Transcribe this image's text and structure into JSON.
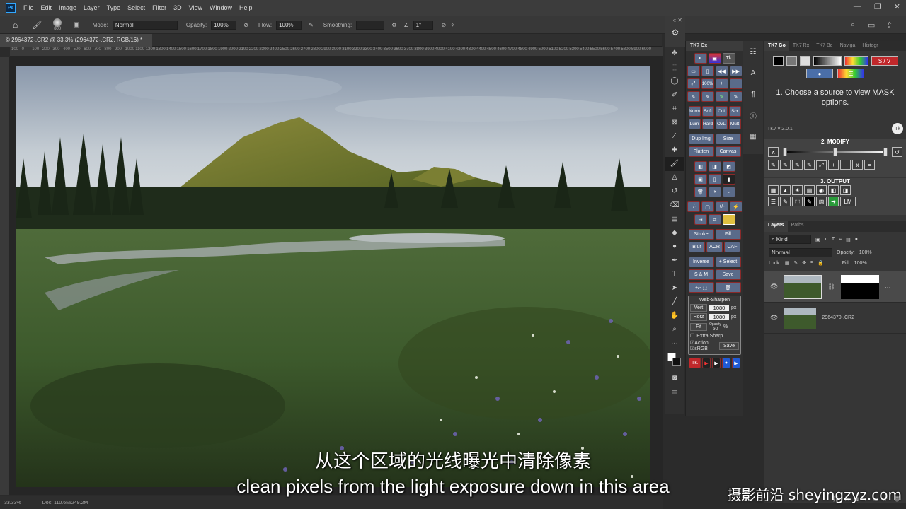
{
  "menu": [
    "File",
    "Edit",
    "Image",
    "Layer",
    "Type",
    "Select",
    "Filter",
    "3D",
    "View",
    "Window",
    "Help"
  ],
  "app_logo": "Ps",
  "options": {
    "brush_size": "800",
    "mode_label": "Mode:",
    "mode_value": "Normal",
    "opacity_label": "Opacity:",
    "opacity_value": "100%",
    "flow_label": "Flow:",
    "flow_value": "100%",
    "smoothing_label": "Smoothing:",
    "angle_value": "1°"
  },
  "document_tab": "© 2964372-.CR2 @ 33.3% (2964372-.CR2, RGB/16) *",
  "ruler_h": [
    "100",
    "0",
    "100",
    "200",
    "300",
    "400",
    "500",
    "600",
    "700",
    "800",
    "900",
    "1000",
    "1100",
    "1200",
    "1300",
    "1400",
    "1500",
    "1600",
    "1700",
    "1800",
    "1900",
    "2000",
    "2100",
    "2200",
    "2300",
    "2400",
    "2500",
    "2600",
    "2700",
    "2800",
    "2900",
    "3000",
    "3100",
    "3200",
    "3300",
    "3400",
    "3500",
    "3600",
    "3700",
    "3800",
    "3900",
    "4000",
    "4100",
    "4200",
    "4300",
    "4400",
    "4500",
    "4600",
    "4700",
    "4800",
    "4900",
    "5000",
    "5100",
    "5200",
    "5300",
    "5400",
    "5500",
    "5600",
    "5700",
    "5800",
    "5900",
    "6000"
  ],
  "status": {
    "zoom": "33.33%",
    "doc": "Doc: 110.6M/249.2M"
  },
  "subtitles": {
    "cn": "从这个区域的光线曝光中清除像素",
    "en": "clean pixels from the light exposure down in this area"
  },
  "watermark": "摄影前沿 sheyingzyz.com",
  "tk7": {
    "title": "TK7 Cx",
    "zoom": "100%",
    "row_norm": [
      "Norm",
      "Soft",
      "Col",
      "Scr"
    ],
    "row_lum": [
      "Lum",
      "Hard",
      "OvL",
      "Mult"
    ],
    "dup": "Dup Img",
    "size": "Size",
    "flatten": "Flatten",
    "canvas": "Canvas",
    "stroke": "Stroke",
    "fill": "Fill",
    "blur": "Blur",
    "acr": "ACR",
    "caf": "CAF",
    "inverse": "Inverse",
    "plus_select": "+ Select",
    "sm": "S & M",
    "save": "Save",
    "web_sharpen": "Web-Sharpen",
    "vert": "Vert",
    "horz": "Horz",
    "fit": "Fit",
    "vert_px": "1080",
    "horz_px": "1080",
    "px": "px",
    "opacity_label": "Opacity",
    "opacity_value": "50",
    "pct": "%",
    "extra_sharp": "Extra Sharp",
    "action": "Action",
    "srgb": "sRGB",
    "ws_save": "Save",
    "tk": "TK"
  },
  "right_tabs": [
    "TK7 Go",
    "TK7 Rx",
    "TK7 Be",
    "Naviga",
    "Histogr"
  ],
  "mask": {
    "sv": "S / V",
    "instruction": "1. Choose a source to view MASK options.",
    "version": "TK7 v 2.0.1",
    "modify": "2. MODIFY",
    "output": "3. OUTPUT",
    "lm": "LM"
  },
  "layers": {
    "tabs": [
      "Layers",
      "Paths"
    ],
    "kind": "Kind",
    "blend": "Normal",
    "opacity_label": "Opacity:",
    "opacity_value": "100%",
    "lock_label": "Lock:",
    "fill_label": "Fill:",
    "fill_value": "100%",
    "bottom_layer": "2964370-.CR2"
  },
  "colors": {
    "accent_red": "#c0282b",
    "accent_blue": "#1f5bd6",
    "panel": "#363636"
  }
}
